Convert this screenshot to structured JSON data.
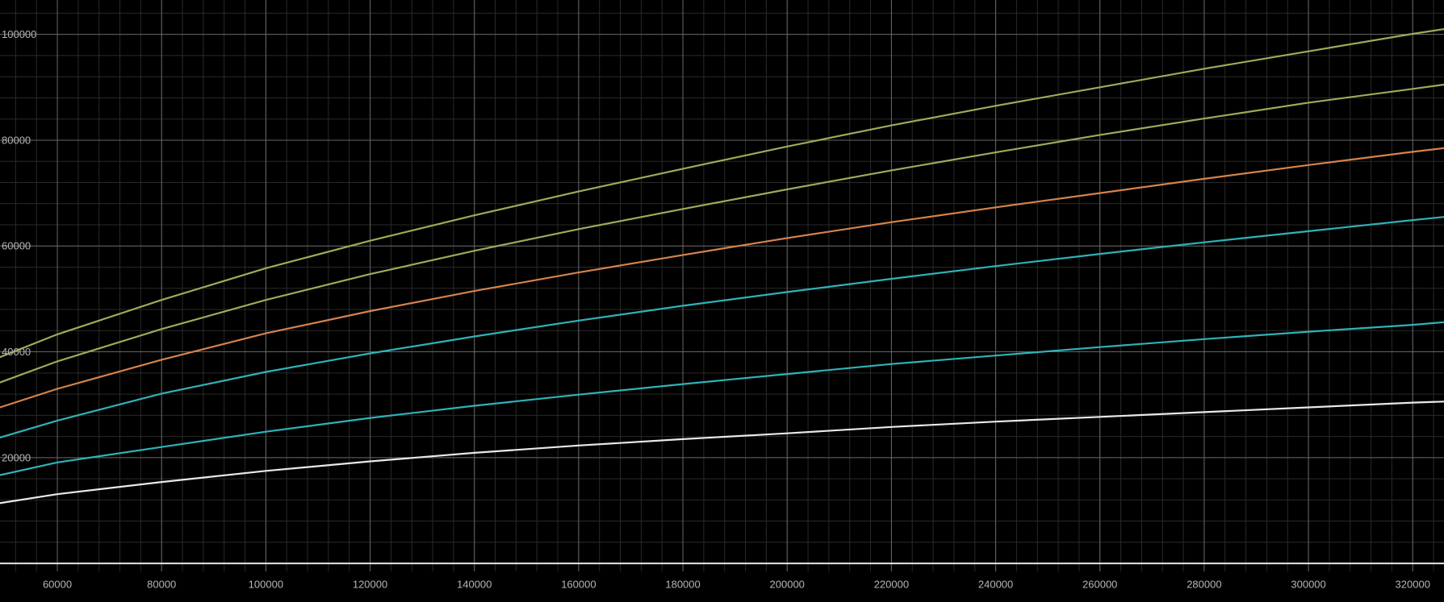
{
  "chart_data": {
    "type": "line",
    "title": "",
    "xlabel": "",
    "ylabel": "",
    "xlim": [
      49000,
      326000
    ],
    "ylim": [
      -1500,
      106500
    ],
    "grid": true,
    "x_ticks": [
      {
        "value": 60000,
        "label": "60000"
      },
      {
        "value": 80000,
        "label": "80000"
      },
      {
        "value": 100000,
        "label": "100000"
      },
      {
        "value": 120000,
        "label": "120000"
      },
      {
        "value": 140000,
        "label": "140000"
      },
      {
        "value": 160000,
        "label": "160000"
      },
      {
        "value": 180000,
        "label": "180000"
      },
      {
        "value": 200000,
        "label": "200000"
      },
      {
        "value": 220000,
        "label": "220000"
      },
      {
        "value": 240000,
        "label": "240000"
      },
      {
        "value": 260000,
        "label": "260000"
      },
      {
        "value": 280000,
        "label": "280000"
      },
      {
        "value": 300000,
        "label": "300000"
      },
      {
        "value": 320000,
        "label": "320000"
      }
    ],
    "y_ticks": [
      {
        "value": 20000,
        "label": "20000"
      },
      {
        "value": 40000,
        "label": "40000"
      },
      {
        "value": 60000,
        "label": "60000"
      },
      {
        "value": 80000,
        "label": "80000"
      },
      {
        "value": 100000,
        "label": "100000"
      }
    ],
    "x": [
      49000,
      60000,
      80000,
      100000,
      120000,
      140000,
      160000,
      180000,
      200000,
      220000,
      240000,
      260000,
      280000,
      300000,
      320000,
      326000
    ],
    "series": [
      {
        "color": "#9aac59",
        "values": [
          39000,
          43300,
          49800,
          55800,
          61000,
          65800,
          70300,
          74600,
          78800,
          82800,
          86500,
          90000,
          93500,
          96800,
          100100,
          101000
        ]
      },
      {
        "color": "#9aac59",
        "values": [
          34200,
          38200,
          44300,
          49800,
          54700,
          59100,
          63200,
          67000,
          70700,
          74300,
          77700,
          81000,
          84100,
          87100,
          89700,
          90500
        ]
      },
      {
        "color": "#d5834b",
        "values": [
          29500,
          33000,
          38500,
          43500,
          47700,
          51500,
          55000,
          58300,
          61500,
          64500,
          67300,
          70000,
          72700,
          75300,
          77800,
          78500
        ]
      },
      {
        "color": "#2fb2b9",
        "values": [
          23800,
          27000,
          32100,
          36200,
          39700,
          42900,
          45900,
          48700,
          51300,
          53800,
          56200,
          58500,
          60700,
          62800,
          64900,
          65500
        ]
      },
      {
        "color": "#2fb2b9",
        "values": [
          16700,
          19100,
          22000,
          24900,
          27500,
          29800,
          31900,
          33900,
          35800,
          37700,
          39300,
          40900,
          42400,
          43800,
          45100,
          45600
        ]
      },
      {
        "color": "#e9e9e9",
        "values": [
          11400,
          13100,
          15400,
          17500,
          19300,
          20900,
          22300,
          23500,
          24600,
          25800,
          26800,
          27700,
          28600,
          29500,
          30400,
          30600
        ]
      }
    ],
    "colors": {
      "background": "#000000",
      "grid_major": "#666666",
      "grid_minor": "#2a2a2a",
      "axis": "#e6e6e6",
      "tick_label": "#b5b5b5"
    }
  }
}
